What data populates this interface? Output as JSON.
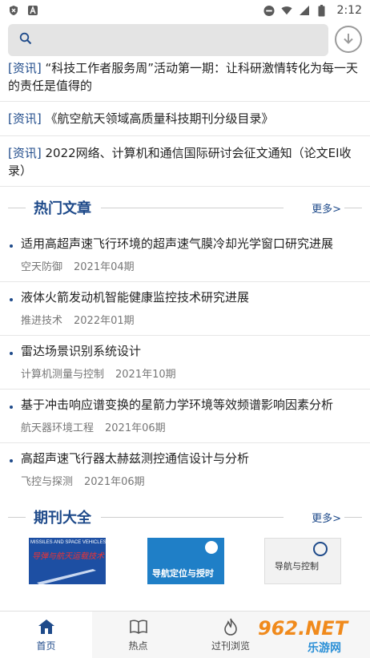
{
  "status_bar": {
    "time": "2:12",
    "left_icons": [
      "shield-x-icon",
      "letter-a-icon"
    ],
    "right_icons": [
      "do-not-disturb-icon",
      "wifi-icon",
      "signal-icon",
      "battery-icon"
    ]
  },
  "search": {
    "placeholder": "",
    "icon": "search-icon",
    "download_icon": "download-icon"
  },
  "news": [
    {
      "tag": "[资讯]",
      "title": " “科技工作者服务周”活动第一期：让科研激情转化为每一天的责任是值得的"
    },
    {
      "tag": "[资讯]",
      "title": " 《航空航天领域高质量科技期刊分级目录》"
    },
    {
      "tag": "[资讯]",
      "title": " 2022网络、计算机和通信国际研讨会征文通知（论文EI收录）"
    }
  ],
  "hot_articles": {
    "title": "热门文章",
    "more": "更多>",
    "items": [
      {
        "title": "适用高超声速飞行环境的超声速气膜冷却光学窗口研究进展",
        "journal": "空天防御",
        "issue": "2021年04期"
      },
      {
        "title": "液体火箭发动机智能健康监控技术研究进展",
        "journal": "推进技术",
        "issue": "2022年01期"
      },
      {
        "title": "雷达场景识别系统设计",
        "journal": "计算机测量与控制",
        "issue": "2021年10期"
      },
      {
        "title": "基于冲击响应谱变换的星箭力学环境等效频谱影响因素分析",
        "journal": "航天器环境工程",
        "issue": "2021年06期"
      },
      {
        "title": "高超声速飞行器太赫兹测控通信设计与分析",
        "journal": "飞控与探测",
        "issue": "2021年06期"
      }
    ]
  },
  "journals": {
    "title": "期刊大全",
    "more": "更多>",
    "covers": [
      {
        "text_en": "MISSILES AND SPACE VEHICLES",
        "text_cn": "导弹与航天运载技术",
        "color": "#1d4fa3"
      },
      {
        "text_cn": "导航定位与授时",
        "color": "#1f7fc7"
      },
      {
        "text_cn": "导航与控制",
        "color": "#f2f2f2"
      }
    ]
  },
  "bottom_nav": [
    {
      "label": "首页",
      "icon": "home-icon",
      "active": true
    },
    {
      "label": "热点",
      "icon": "book-icon",
      "active": false
    },
    {
      "label": "过刊浏览",
      "icon": "fire-icon",
      "active": false
    }
  ],
  "watermark": {
    "text": "962.NET",
    "subtext": "乐游网"
  },
  "colors": {
    "accent": "#1e4a8a",
    "search_bg": "#e4e4e4",
    "nav_bg": "#f6f6f6"
  }
}
